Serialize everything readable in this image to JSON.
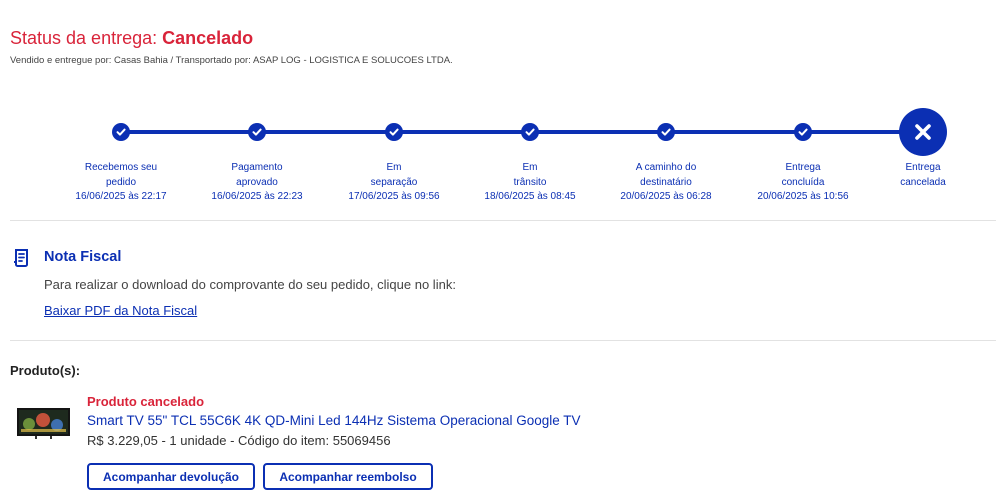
{
  "header": {
    "status_prefix": "Status da entrega: ",
    "status_value": "Cancelado",
    "seller_line": "Vendido e entregue por: Casas Bahia / Transportado por: ASAP LOG - LOGISTICA E SOLUCOES LTDA.",
    "accent_color": "#0b2fb3",
    "alert_color": "#d9243a"
  },
  "tracker": {
    "steps": [
      {
        "line1": "Recebemos seu",
        "line2": "pedido",
        "date": "16/06/2025 às 22:17",
        "state": "done",
        "icon": "check-icon"
      },
      {
        "line1": "Pagamento",
        "line2": "aprovado",
        "date": "16/06/2025 às 22:23",
        "state": "done",
        "icon": "check-icon"
      },
      {
        "line1": "Em",
        "line2": "separação",
        "date": "17/06/2025 às 09:56",
        "state": "done",
        "icon": "check-icon"
      },
      {
        "line1": "Em",
        "line2": "trânsito",
        "date": "18/06/2025 às 08:45",
        "state": "done",
        "icon": "check-icon"
      },
      {
        "line1": "A caminho do",
        "line2": "destinatário",
        "date": "20/06/2025 às 06:28",
        "state": "done",
        "icon": "check-icon"
      },
      {
        "line1": "Entrega",
        "line2": "concluída",
        "date": "20/06/2025 às 10:56",
        "state": "done",
        "icon": "check-icon"
      },
      {
        "line1": "Entrega",
        "line2": "cancelada",
        "date": "",
        "state": "cancelled",
        "icon": "close-icon"
      }
    ]
  },
  "nota_fiscal": {
    "icon": "receipt-icon",
    "title": "Nota Fiscal",
    "description": "Para realizar o download do comprovante do seu pedido, clique no link:",
    "link_label": "Baixar PDF da Nota Fiscal"
  },
  "products": {
    "section_label": "Produto(s):",
    "items": [
      {
        "status": "Produto cancelado",
        "name": "Smart TV 55\" TCL 55C6K 4K QD-Mini Led 144Hz Sistema Operacional Google TV",
        "meta": "R$ 3.229,05 - 1 unidade - Código do item: 55069456",
        "thumbnail": "tv-thumbnail",
        "buttons": {
          "return_label": "Acompanhar devolução",
          "refund_label": "Acompanhar reembolso"
        }
      }
    ]
  }
}
